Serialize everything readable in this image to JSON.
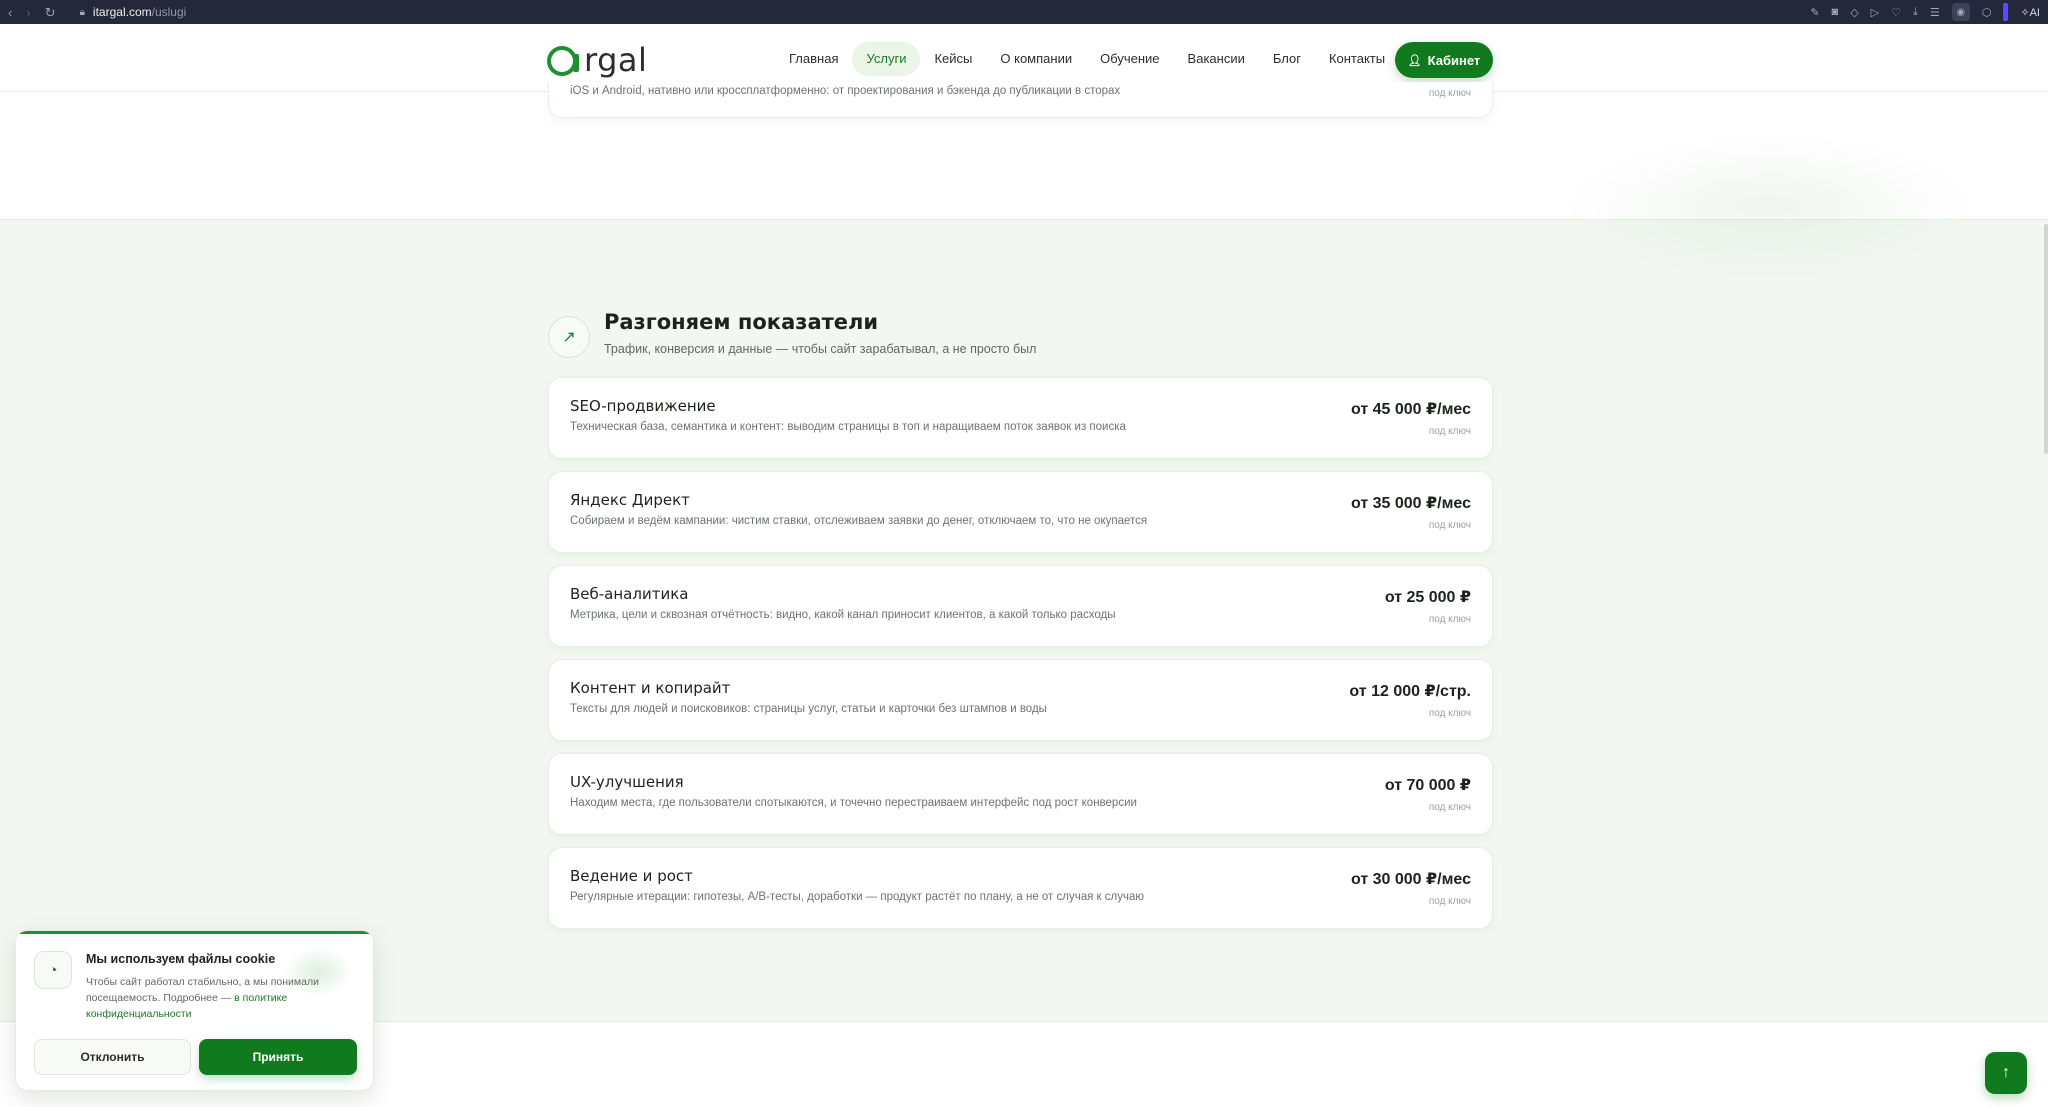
{
  "browser": {
    "url_host": "itargal.com",
    "url_path": "/uslugi",
    "back_icon": "back-arrow-icon",
    "forward_icon": "forward-arrow-icon",
    "reload_icon": "reload-icon",
    "ai_label": "AI"
  },
  "header": {
    "logo_text": "rgal",
    "nav": [
      {
        "label": "Главная"
      },
      {
        "label": "Услуги",
        "active": true
      },
      {
        "label": "Кейсы"
      },
      {
        "label": "О компании"
      },
      {
        "label": "Обучение"
      },
      {
        "label": "Вакансии"
      },
      {
        "label": "Блог"
      },
      {
        "label": "Контакты"
      }
    ],
    "cabinet_label": "Кабинет"
  },
  "prev_card": {
    "desc": "iOS и Android, нативно или кроссплатформенно: от проектирования и бэкенда до публикации в сторах",
    "unit": "под ключ"
  },
  "section": {
    "title": "Разгоняем показатели",
    "subtitle": "Трафик, конверсия и данные — чтобы сайт зарабатывал, а не просто был",
    "icon": "trending-up-icon"
  },
  "services": [
    {
      "title": "SEO-продвижение",
      "desc": "Техническая база, семантика и контент: выводим страницы в топ и наращиваем поток заявок из поиска",
      "price": "от 45 000 ₽/мес",
      "unit": "под ключ"
    },
    {
      "title": "Яндекс Директ",
      "desc": "Собираем и ведём кампании: чистим ставки, отслеживаем заявки до денег, отключаем то, что не окупается",
      "price": "от 35 000 ₽/мес",
      "unit": "под ключ"
    },
    {
      "title": "Веб-аналитика",
      "desc": "Метрика, цели и сквозная отчётность: видно, какой канал приносит клиентов, а какой только расходы",
      "price": "от 25 000 ₽",
      "unit": "под ключ"
    },
    {
      "title": "Контент и копирайт",
      "desc": "Тексты для людей и поисковиков: страницы услуг, статьи и карточки без штампов и воды",
      "price": "от 12 000 ₽/стр.",
      "unit": "под ключ"
    },
    {
      "title": "UX-улучшения",
      "desc": "Находим места, где пользователи спотыкаются, и точечно перестраиваем интерфейс под рост конверсии",
      "price": "от 70 000 ₽",
      "unit": "под ключ"
    },
    {
      "title": "Ведение и рост",
      "desc": "Регулярные итерации: гипотезы, A/B-тесты, доработки — продукт растёт по плану, а не от случая к случаю",
      "price": "от 30 000 ₽/мес",
      "unit": "под ключ"
    }
  ],
  "cookie": {
    "title": "Мы используем файлы cookie",
    "text": "Чтобы сайт работал стабильно, а мы понимали посещаемость. Подробнее — ",
    "link": "в политике конфиденциальности",
    "decline": "Отклонить",
    "accept": "Принять"
  },
  "colors": {
    "brand": "#127a1e",
    "background": "#f2f8f1",
    "card": "#ffffff"
  }
}
